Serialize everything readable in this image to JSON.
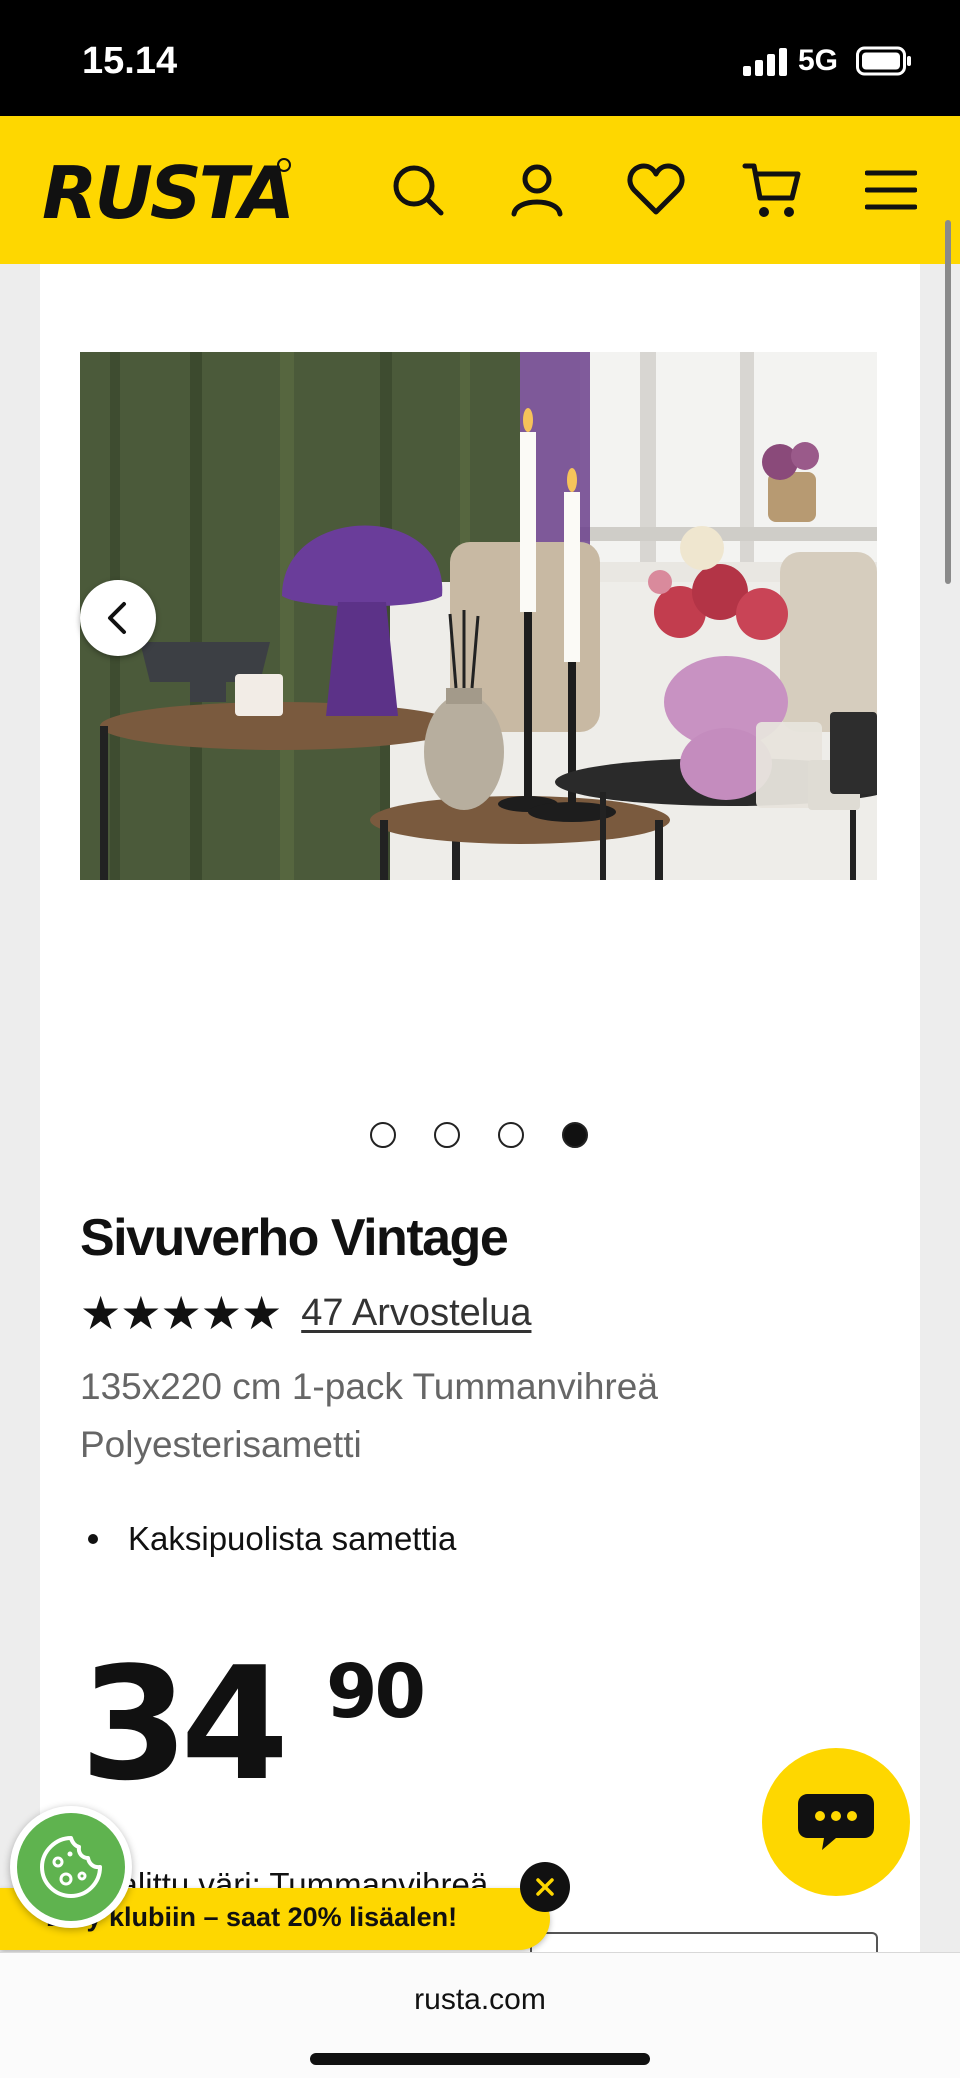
{
  "status_bar": {
    "time": "15.14",
    "network": "5G"
  },
  "header": {
    "logo_text": "RUSTA",
    "icons": [
      "search-icon",
      "account-icon",
      "wishlist-heart-icon",
      "cart-icon",
      "menu-icon"
    ],
    "brand_color": "#fed700"
  },
  "gallery": {
    "slide_count": 4,
    "active_slide": 4
  },
  "product": {
    "title": "Sivuverho Vintage",
    "rating_stars": "★★★★★",
    "rating": 5,
    "reviews_link": "47 Arvostelua",
    "description_line1": "135x220 cm 1-pack Tummanvihreä",
    "description_line2": "Polyesterisametti",
    "bullets": [
      "Kaksipuolista samettia"
    ],
    "price_main": "34",
    "price_cents": "90",
    "selected_color_label": "Valittu väri: Tummanvihreä"
  },
  "promo_banner": {
    "text": "Liity klubiin – saat 20% lisäalen!"
  },
  "browser": {
    "url": "rusta.com"
  }
}
